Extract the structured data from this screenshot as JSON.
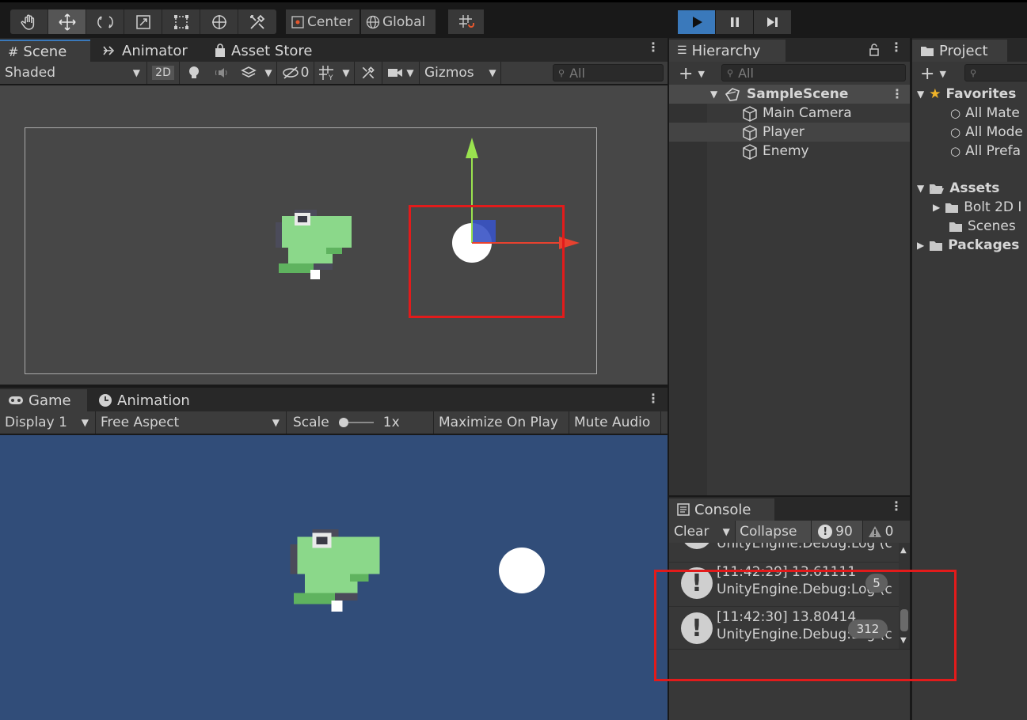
{
  "toolbar": {
    "pivot_label": "Center",
    "space_label": "Global"
  },
  "scene_panel": {
    "tabs": [
      "Scene",
      "Animator",
      "Asset Store"
    ],
    "shading_mode": "Shaded",
    "mode_2d": "2D",
    "hidden_count": "0",
    "gizmos_label": "Gizmos",
    "search_placeholder": "All"
  },
  "game_panel": {
    "tabs": [
      "Game",
      "Animation"
    ],
    "display": "Display 1",
    "aspect": "Free Aspect",
    "scale_label": "Scale",
    "scale_value": "1x",
    "maximize_label": "Maximize On Play",
    "mute_label": "Mute Audio"
  },
  "hierarchy": {
    "title": "Hierarchy",
    "search_placeholder": "All",
    "scene_name": "SampleScene",
    "items": [
      "Main Camera",
      "Player",
      "Enemy"
    ]
  },
  "console": {
    "title": "Console",
    "clear_label": "Clear",
    "collapse_label": "Collapse",
    "warning_count": "90",
    "error_count": "0",
    "logs": [
      {
        "line1": "",
        "line2": "UnityEngine.Debug:Log (c",
        "count": ""
      },
      {
        "line1": "[11:42:29] 13.61111",
        "line2": "UnityEngine.Debug:Log (c",
        "count": "5"
      },
      {
        "line1": "[11:42:30] 13.80414",
        "line2": "UnityEngine.Debug:Log (c",
        "count": "312"
      }
    ]
  },
  "project": {
    "title": "Project",
    "favorites_label": "Favorites",
    "favorites": [
      "All Mate",
      "All Mode",
      "All Prefa"
    ],
    "assets_label": "Assets",
    "assets": [
      "Bolt 2D I",
      "Scenes"
    ],
    "packages_label": "Packages"
  },
  "colors": {
    "accent": "#3a79bb",
    "scene_bg": "#474747",
    "game_bg": "#314d79",
    "highlight_box": "#e21b1b",
    "dino_green": "#8bd88a"
  }
}
